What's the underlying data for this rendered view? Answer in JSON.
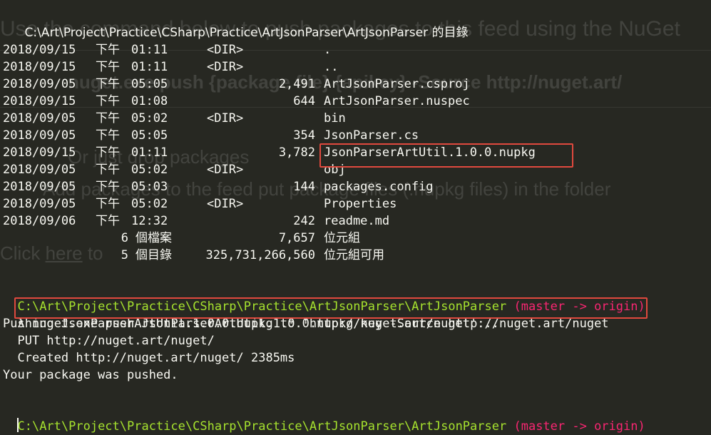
{
  "ghost": {
    "line1": "Use the command below to push packages to this feed using the NuGet",
    "line2": "nuget.exe push {package file} {apikey} -Source http://nuget.art/",
    "line3": "Or just drop packages",
    "line4": "Add packages to the feed put package files (.nupkg files) in the folder",
    "line5_a": "Click ",
    "line5_link": "here",
    "line5_b": " to"
  },
  "terminal": {
    "title": "C:\\Art\\Project\\Practice\\CSharp\\Practice\\ArtJsonParser\\ArtJsonParser 的目錄",
    "listing": [
      {
        "date": "2018/09/15",
        "ampm": "下午",
        "time": "01:11",
        "dir": "<DIR>",
        "size": "",
        "name": "."
      },
      {
        "date": "2018/09/15",
        "ampm": "下午",
        "time": "01:11",
        "dir": "<DIR>",
        "size": "",
        "name": ".."
      },
      {
        "date": "2018/09/05",
        "ampm": "下午",
        "time": "05:05",
        "dir": "",
        "size": "2,491",
        "name": "ArtJsonParser.csproj"
      },
      {
        "date": "2018/09/15",
        "ampm": "下午",
        "time": "01:08",
        "dir": "",
        "size": "644",
        "name": "ArtJsonParser.nuspec"
      },
      {
        "date": "2018/09/05",
        "ampm": "下午",
        "time": "05:02",
        "dir": "<DIR>",
        "size": "",
        "name": "bin"
      },
      {
        "date": "2018/09/05",
        "ampm": "下午",
        "time": "05:05",
        "dir": "",
        "size": "354",
        "name": "JsonParser.cs"
      },
      {
        "date": "2018/09/15",
        "ampm": "下午",
        "time": "01:11",
        "dir": "",
        "size": "3,782",
        "name": "JsonParserArtUtil.1.0.0.nupkg"
      },
      {
        "date": "2018/09/05",
        "ampm": "下午",
        "time": "05:02",
        "dir": "<DIR>",
        "size": "",
        "name": "obj"
      },
      {
        "date": "2018/09/05",
        "ampm": "下午",
        "time": "05:03",
        "dir": "",
        "size": "144",
        "name": "packages.config"
      },
      {
        "date": "2018/09/05",
        "ampm": "下午",
        "time": "05:02",
        "dir": "<DIR>",
        "size": "",
        "name": "Properties"
      },
      {
        "date": "2018/09/06",
        "ampm": "下午",
        "time": "12:32",
        "dir": "",
        "size": "242",
        "name": "readme.md"
      }
    ],
    "summary_files": {
      "count": "6",
      "label": "個檔案",
      "bytes": "7,657",
      "unit": "位元組"
    },
    "summary_dirs": {
      "count": "5",
      "label": "個目錄",
      "bytes": "325,731,266,560",
      "unit": "位元組可用"
    },
    "prompt_path": "C:\\Art\\Project\\Practice\\CSharp\\Practice\\ArtJsonParser\\ArtJsonParser",
    "prompt_branch": "(master -> origin)",
    "lambda": "λ",
    "command": "nuget.exe push JsonParserArtUtil.1.0.0.nupkg key -Source http://nuget.art/nuget",
    "output": [
      "Pushing JsonParserArtUtil.1.0.0.nupkg to 'http://nuget.art/nuget'...",
      "  PUT http://nuget.art/nuget/",
      "  Created http://nuget.art/nuget/ 2385ms",
      "Your package was pushed."
    ]
  },
  "colors": {
    "background": "#272822",
    "foreground": "#f8f8f2",
    "prompt_path": "#a6e22e",
    "prompt_branch": "#f92672",
    "highlight_box": "#e0493e"
  }
}
